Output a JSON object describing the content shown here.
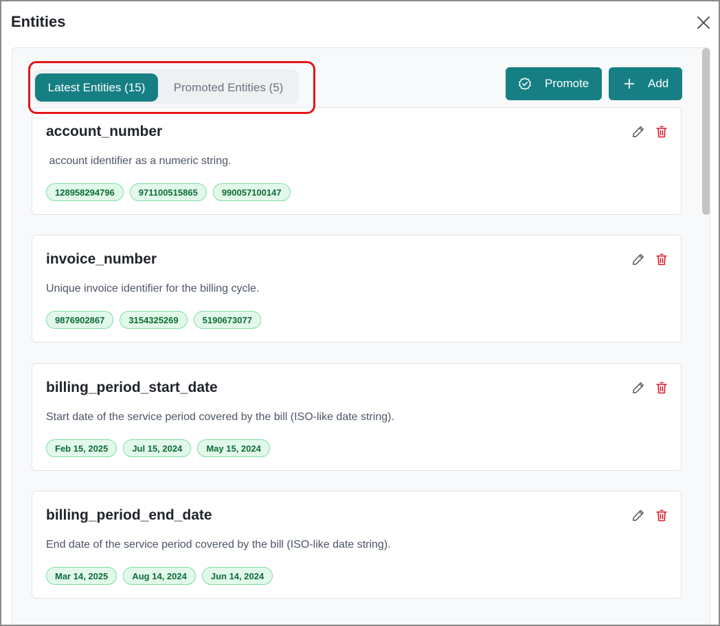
{
  "dialog": {
    "title": "Entities"
  },
  "tabs": [
    {
      "label": "Latest Entities (15)",
      "active": true
    },
    {
      "label": "Promoted Entities (5)",
      "active": false
    }
  ],
  "actions": {
    "promote_label": "Promote",
    "promote_icon": "check-circle-icon",
    "add_label": "Add",
    "add_icon": "plus-icon"
  },
  "colors": {
    "accent": "#167f84",
    "highlight": "#e5141b",
    "delete": "#d61b2a",
    "tag_bg": "#e2f9ea",
    "tag_text": "#0d6b35"
  },
  "entities": [
    {
      "name": "account_number",
      "description": " account identifier as a numeric string.",
      "examples": [
        "128958294796",
        "971100515865",
        "990057100147"
      ]
    },
    {
      "name": "invoice_number",
      "description": "Unique invoice identifier for the billing cycle.",
      "examples": [
        "9876902867",
        "3154325269",
        "5190673077"
      ]
    },
    {
      "name": "billing_period_start_date",
      "description": "Start date of the service period covered by the bill (ISO-like date string).",
      "examples": [
        "Feb 15, 2025",
        "Jul 15, 2024",
        "May 15, 2024"
      ]
    },
    {
      "name": "billing_period_end_date",
      "description": "End date of the service period covered by the bill (ISO-like date string).",
      "examples": [
        "Mar 14, 2025",
        "Aug 14, 2024",
        "Jun 14, 2024"
      ]
    }
  ]
}
